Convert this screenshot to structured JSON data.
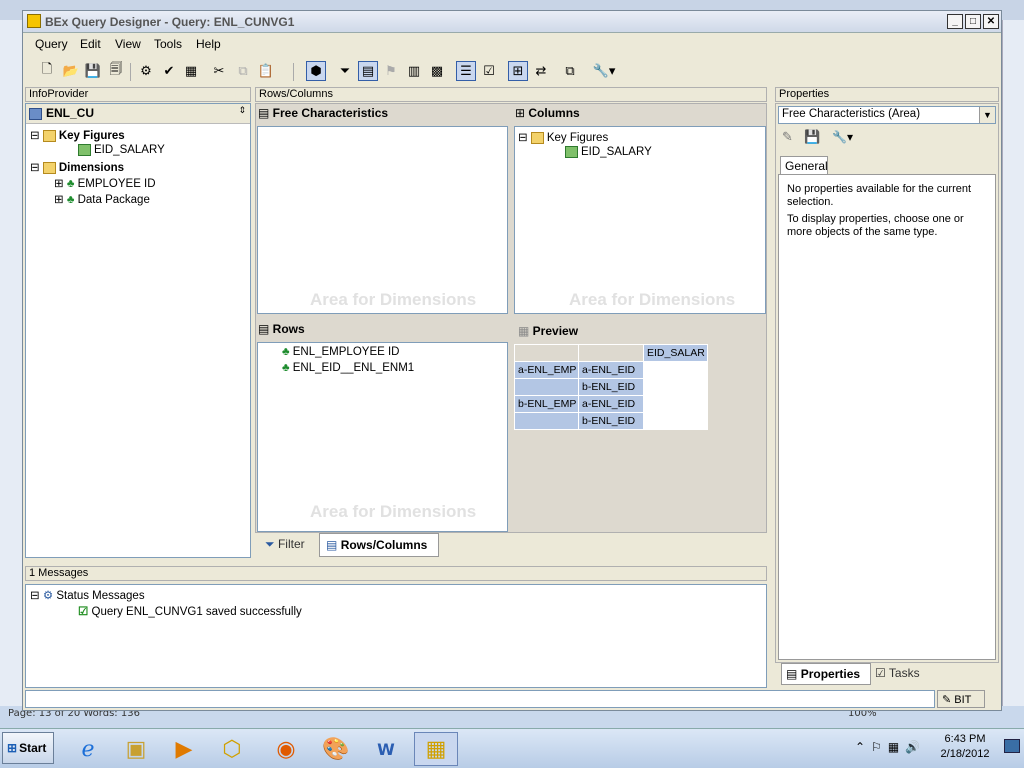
{
  "bg": {
    "status_text": "Page: 13 of 20    Words: 136",
    "zoom": "100%"
  },
  "window": {
    "title": "BEx Query Designer - Query: ENL_CUNVG1"
  },
  "menu": [
    "Query",
    "Edit",
    "View",
    "Tools",
    "Help"
  ],
  "infoprovider": {
    "header": "InfoProvider",
    "name": "ENL_CU",
    "nodes": [
      {
        "label": "Key Figures",
        "bold": true
      },
      {
        "label": "EID_SALARY"
      },
      {
        "label": "Dimensions",
        "bold": true
      },
      {
        "label": "EMPLOYEE ID"
      },
      {
        "label": "Data Package"
      }
    ]
  },
  "rows_columns": {
    "header": "Rows/Columns",
    "free_characteristics": "Free Characteristics",
    "columns": "Columns",
    "columns_tree": [
      "Key Figures",
      "EID_SALARY"
    ],
    "rows": "Rows",
    "rows_tree": [
      "ENL_EMPLOYEE ID",
      "ENL_EID__ENL_ENM1"
    ],
    "watermark": "Area for Dimensions",
    "preview": "Preview",
    "preview_grid": {
      "col_header": "EID_SALAR",
      "rows": [
        {
          "a": "a-ENL_EMP",
          "b": "a-ENL_EID"
        },
        {
          "a": "",
          "b": "b-ENL_EID"
        },
        {
          "a": "b-ENL_EMP",
          "b": "a-ENL_EID"
        },
        {
          "a": "",
          "b": "b-ENL_EID"
        }
      ]
    },
    "tabs": [
      "Filter",
      "Rows/Columns"
    ]
  },
  "properties": {
    "header": "Properties",
    "select_value": "Free Characteristics (Area)",
    "tab": "General",
    "msg1": "No properties available for the current selection.",
    "msg2": "To display properties, choose one or more objects of the same type.",
    "bottom_tabs": [
      "Properties",
      "Tasks"
    ]
  },
  "messages": {
    "header": "1 Messages",
    "status": "Status Messages",
    "item": "Query ENL_CUNVG1 saved successfully"
  },
  "statusbar": {
    "bit": "BIT"
  },
  "taskbar": {
    "start": "Start",
    "time": "6:43 PM",
    "date": "2/18/2012"
  }
}
